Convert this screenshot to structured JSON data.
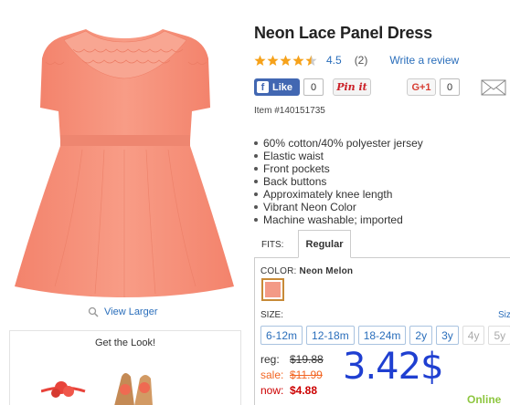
{
  "product": {
    "title": "Neon Lace Panel Dress",
    "rating_value": "4.5",
    "rating_stars": 4.5,
    "rating_count": "(2)",
    "write_review": "Write a review",
    "item_number": "Item #140151735",
    "features": [
      "60% cotton/40% polyester jersey",
      "Elastic waist",
      "Front pockets",
      "Back buttons",
      "Approximately knee length",
      "Vibrant Neon Color",
      "Machine washable; imported"
    ]
  },
  "social": {
    "like_label": "Like",
    "like_count": "0",
    "pinit_label": "Pin it",
    "gplus_label": "G+1",
    "gplus_count": "0"
  },
  "left": {
    "view_larger": "View Larger",
    "get_the_look": "Get the Look!"
  },
  "fits": {
    "label": "FITS:",
    "tab": "Regular"
  },
  "options": {
    "color_label": "COLOR:",
    "color_value": "Neon Melon",
    "color_hex": "#f39a86",
    "size_label": "SIZE:",
    "size_link": "Size",
    "sizes": [
      {
        "label": "6-12m",
        "available": true
      },
      {
        "label": "12-18m",
        "available": true
      },
      {
        "label": "18-24m",
        "available": true
      },
      {
        "label": "2y",
        "available": true
      },
      {
        "label": "3y",
        "available": true
      },
      {
        "label": "4y",
        "available": false
      },
      {
        "label": "5y",
        "available": false
      }
    ]
  },
  "pricing": {
    "reg_label": "reg:",
    "reg_value": "$19.88",
    "sale_label": "sale:",
    "sale_value": "$11.99",
    "now_label": "now:",
    "now_value": "$4.88",
    "big_price": "3.42$",
    "online": "Online"
  },
  "colors": {
    "dress": "#f7907c",
    "link": "#2a6ebb",
    "big_price": "#1f3fd1",
    "online": "#8dc63f",
    "sale": "#f26522",
    "now": "#cc0000"
  }
}
